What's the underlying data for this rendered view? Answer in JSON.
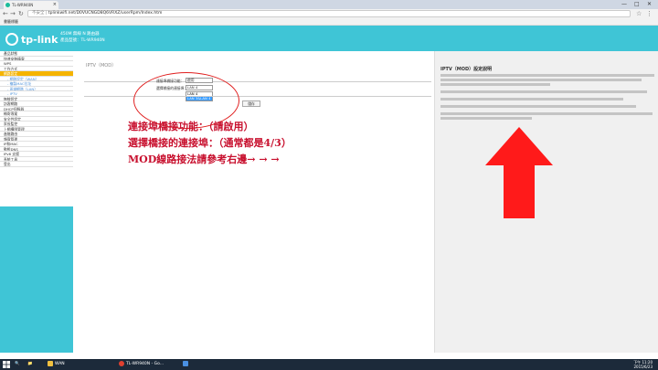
{
  "browser": {
    "tab_title": "TL-WR940N",
    "url_prefix": "不安全 |",
    "url": "tplinkwifi.net/D0VUCNGD8Q6VRXZ/userRpm/Index.htm",
    "bookmark": "書籤標籤",
    "win_min": "—",
    "win_max": "□",
    "win_close": "✕"
  },
  "header": {
    "logo_text": "tp-link",
    "product_name": "450M 無線 N 路由器",
    "model": "產品型號：TL-WR940N"
  },
  "sidebar": {
    "items": [
      {
        "label": "產品狀態"
      },
      {
        "label": "快速安裝精靈"
      },
      {
        "label": "WPS"
      },
      {
        "label": "工作方式"
      },
      {
        "label": "網路設定",
        "active": true
      },
      {
        "label": "- 網路設定（WAN）",
        "sub": true
      },
      {
        "label": "- 複製MAC位址",
        "sub": true
      },
      {
        "label": "- 區域網路（LAN）",
        "sub": true
      },
      {
        "label": "- IPTV",
        "sub": true
      },
      {
        "label": "無線設定"
      },
      {
        "label": "訪客網路"
      },
      {
        "label": "DHCP伺服器"
      },
      {
        "label": "轉寄專案"
      },
      {
        "label": "安全性設定"
      },
      {
        "label": "家長監控"
      },
      {
        "label": "上網權限管理"
      },
      {
        "label": "進階路由"
      },
      {
        "label": "頻寬管理"
      },
      {
        "label": "IP和MAC"
      },
      {
        "label": "動態DNS"
      },
      {
        "label": "IPv6 支援"
      },
      {
        "label": "系統工具"
      },
      {
        "label": "登出"
      }
    ]
  },
  "main": {
    "title": "IPTV（MOD）",
    "bridge_label": "連接埠橋接功能：",
    "bridge_value": "啟用",
    "port_label": "選擇橋接的連接埠：",
    "port_value": "LAN 4",
    "dropdown_options": [
      "LAN 4",
      "LAN 3&LAN 4"
    ],
    "dropdown_selected_index": 1,
    "save_label": "儲存"
  },
  "annotation": {
    "line1": "連接埠橋接功能：（請啟用）",
    "line2": "選擇橋接的連接埠：（通常都是4/3）",
    "line3": "MOD線路接法請參考右邊→ → →",
    "color": "#c8102e"
  },
  "help": {
    "title": "IPTV（MOD）設定說明"
  },
  "taskbar": {
    "item1": "WAN",
    "item2": "TL-WR940N - Go...",
    "clock_time": "下午 11:20",
    "clock_date": "2015/6/23"
  },
  "colors": {
    "accent": "#3fc5d6",
    "active_menu": "#f5b400",
    "arrow": "#ff1a1a"
  }
}
